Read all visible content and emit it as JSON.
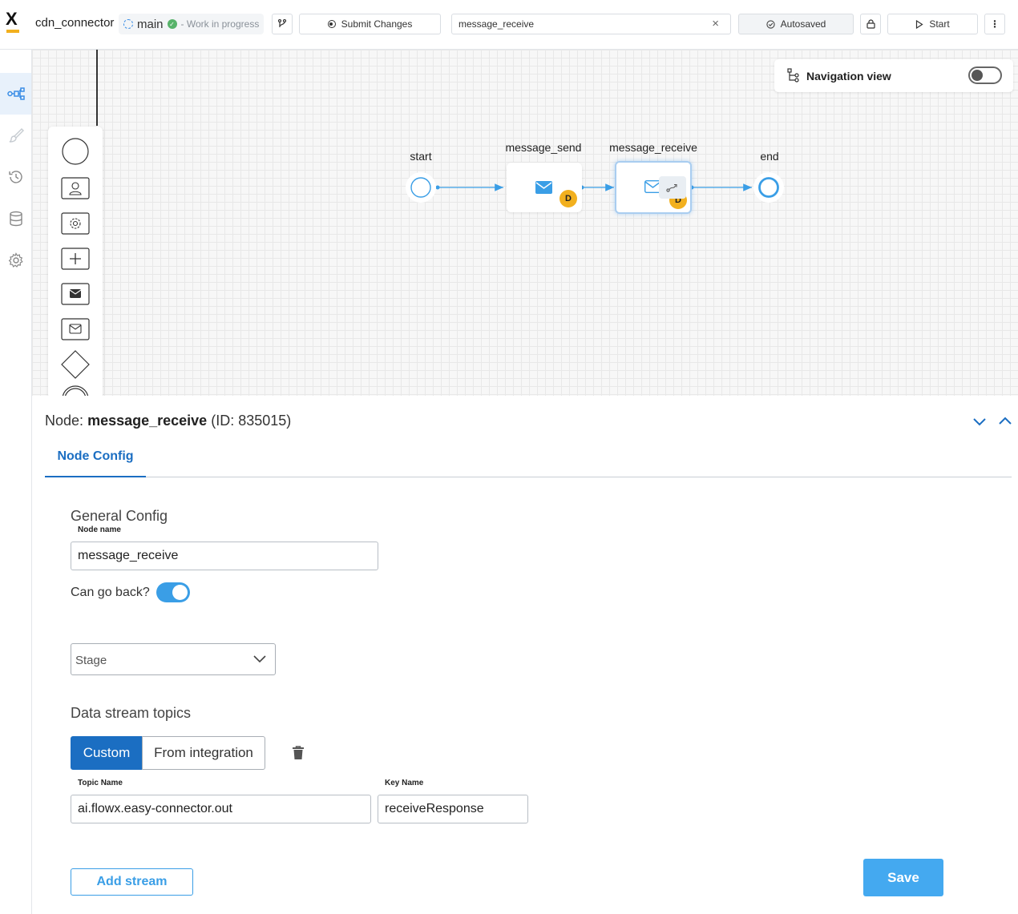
{
  "header": {
    "process_name": "cdn_connector",
    "branch": "main",
    "status": "- Work in progress",
    "submit_label": "Submit Changes",
    "search_value": "message_receive",
    "autosaved_label": "Autosaved",
    "start_label": "Start"
  },
  "sidebar": {
    "items": [
      {
        "icon": "process-diagram-icon",
        "active": true
      },
      {
        "icon": "brush-icon",
        "active": false
      },
      {
        "icon": "history-icon",
        "active": false
      },
      {
        "icon": "database-icon",
        "active": false
      },
      {
        "icon": "gear-icon",
        "active": false
      }
    ]
  },
  "canvas": {
    "navigation_view_label": "Navigation view",
    "navigation_view_enabled": false,
    "palette": [
      "start-event-icon",
      "user-task-icon",
      "service-task-icon",
      "subprocess-icon",
      "message-send-icon",
      "message-receive-icon",
      "gateway-icon",
      "end-event-icon"
    ],
    "nodes": {
      "start": "start",
      "send": "message_send",
      "receive": "message_receive",
      "end": "end",
      "badge": "D"
    }
  },
  "panel": {
    "title_prefix": "Node:",
    "node_name": "message_receive",
    "node_id": "(ID: 835015)",
    "tab": "Node Config",
    "general_config": "General Config",
    "node_name_label": "Node name",
    "node_name_value": "message_receive",
    "can_go_back_label": "Can go back?",
    "can_go_back": true,
    "stage_placeholder": "Stage",
    "data_stream_title": "Data stream topics",
    "seg_custom": "Custom",
    "seg_integration": "From integration",
    "topic_label": "Topic Name",
    "topic_value": "ai.flowx.easy-connector.out",
    "key_label": "Key Name",
    "key_value": "receiveResponse",
    "add_stream": "Add stream",
    "save": "Save"
  },
  "colors": {
    "accent": "#1b6ec2",
    "primary_light": "#44a9f0",
    "badge": "#f2b01e",
    "flow": "#3a9ee6"
  }
}
